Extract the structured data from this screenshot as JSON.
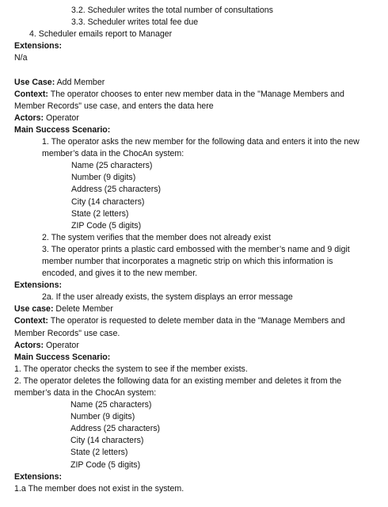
{
  "top_list": {
    "item_3_2": "3.2. Scheduler writes the total number of consultations",
    "item_3_3": "3.3. Scheduler writes total fee due",
    "item_4": "4.  Scheduler emails report to Manager"
  },
  "labels": {
    "extensions": "Extensions:",
    "use_case": "Use Case:",
    "use_case_lower": "Use case:",
    "context": "Context:",
    "actors": "Actors:",
    "main_success_scenario": "Main Success Scenario:"
  },
  "first_extensions_value": "N/a",
  "add_member": {
    "name": " Add Member",
    "context_line1": " The operator chooses to enter new member data in the \"Manage Members and",
    "context_line2": "Member Records\" use case, and enters the data here",
    "actors": " Operator",
    "step1_line1": "1. The operator asks the new member for the following data and enters it into the new",
    "step1_line2": "member’s data in the ChocAn system:",
    "fields": [
      "Name (25 characters)",
      "Number (9 digits)",
      "Address (25 characters)",
      "City (14 characters)",
      "State (2 letters)",
      "ZIP Code (5 digits)"
    ],
    "step2": "2. The system verifies that the member does not already exist",
    "step3_line1": "3. The operator prints a plastic card embossed with the member’s name and 9 digit",
    "step3_line2": "member number that incorporates a magnetic strip on which this information is",
    "step3_line3": "encoded, and gives it to the new member.",
    "extension_2a": "2a. If the user already exists, the system displays an error message"
  },
  "delete_member": {
    "name": " Delete Member",
    "context_line1": " The operator is requested to delete member data in the \"Manage Members and",
    "context_line2": "Member Records\" use case.",
    "actors": " Operator",
    "step1": "1. The operator checks the system to see if the member exists.",
    "step2_line1": "2. The operator deletes the following data for an existing member and deletes it from the",
    "step2_line2": "member’s data in the ChocAn system:",
    "fields": [
      "Name (25 characters)",
      "Number (9 digits)",
      "Address (25 characters)",
      "City (14 characters)",
      "State (2 letters)",
      "ZIP Code (5 digits)"
    ],
    "extension_1a": "1.a The member does not exist in the system."
  }
}
